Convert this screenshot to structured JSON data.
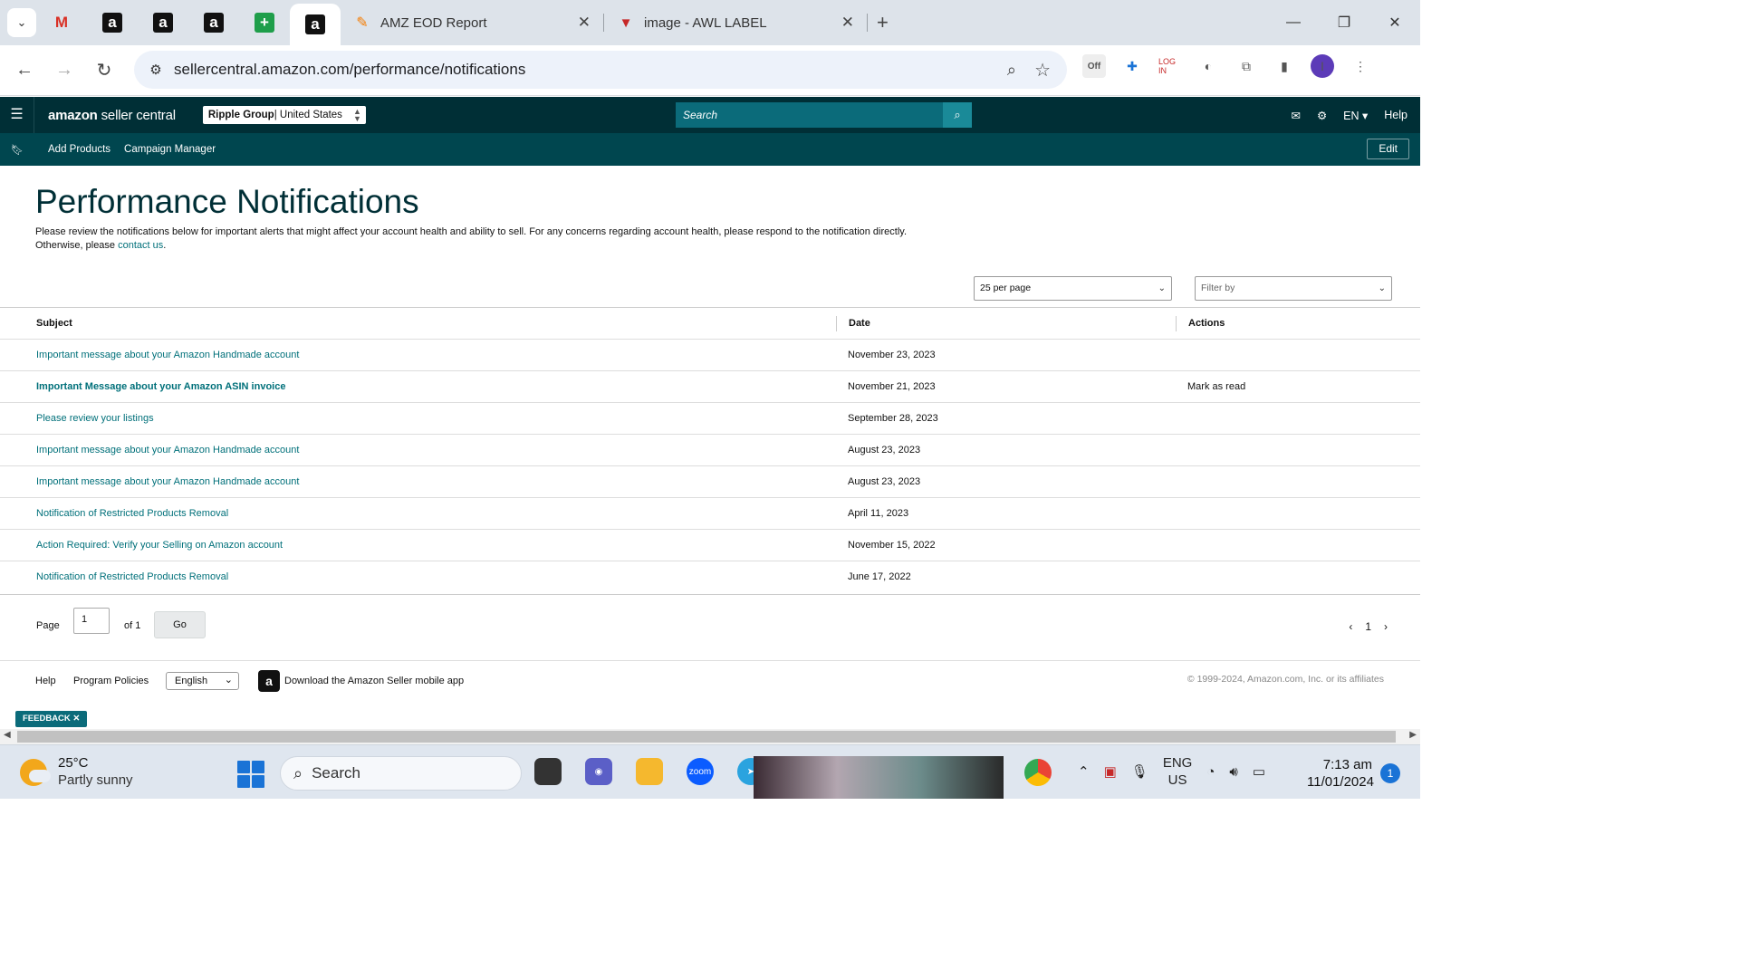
{
  "browser": {
    "tabs": [
      {
        "label": "AMZ EOD Report"
      },
      {
        "label": "image - AWL LABEL"
      }
    ],
    "url": "sellercentral.amazon.com/performance/notifications"
  },
  "header": {
    "logo_brand": "amazon",
    "logo_suffix": " seller central",
    "account_name": "Ripple Group",
    "account_region": " | United States",
    "search_placeholder": "Search",
    "lang": "EN",
    "help": "Help"
  },
  "bookmarks": {
    "items": [
      "Add Products",
      "Campaign Manager"
    ],
    "edit": "Edit"
  },
  "page": {
    "title": "Performance Notifications",
    "intro": "Please review the notifications below for important alerts that might affect your account health and ability to sell. For any concerns regarding account health, please respond to the notification directly. Otherwise, please",
    "contact_link": "contact us",
    "intro_end": ".",
    "per_page": "25 per page",
    "filter_placeholder": "Filter by"
  },
  "table": {
    "headers": [
      "Subject",
      "Date",
      "Actions"
    ],
    "rows": [
      {
        "subject": "Important message about your Amazon Handmade account",
        "date": "November 23, 2023",
        "action": ""
      },
      {
        "subject": "Important Message about your Amazon ASIN invoice",
        "date": "November 21, 2023",
        "action": "Mark as read"
      },
      {
        "subject": "Please review your listings",
        "date": "September 28, 2023",
        "action": ""
      },
      {
        "subject": "Important message about your Amazon Handmade account",
        "date": "August 23, 2023",
        "action": ""
      },
      {
        "subject": "Important message about your Amazon Handmade account",
        "date": "August 23, 2023",
        "action": ""
      },
      {
        "subject": "Notification of Restricted Products Removal",
        "date": "April 11, 2023",
        "action": ""
      },
      {
        "subject": "Action Required: Verify your Selling on Amazon account",
        "date": "November 15, 2022",
        "action": ""
      },
      {
        "subject": "Notification of Restricted Products Removal",
        "date": "June 17, 2022",
        "action": ""
      }
    ]
  },
  "pager": {
    "page_label": "Page",
    "page_value": "1",
    "of_label": "of 1",
    "go": "Go",
    "current": "1"
  },
  "footer": {
    "help": "Help",
    "policies": "Program Policies",
    "language": "English",
    "app": "Download the Amazon Seller mobile app",
    "copyright": "© 1999-2024, Amazon.com, Inc. or its affiliates",
    "feedback": "FEEDBACK"
  },
  "taskbar": {
    "temp": "25°C",
    "weather": "Partly sunny",
    "search": "Search",
    "lang1": "ENG",
    "lang2": "US",
    "time": "7:13 am",
    "date": "11/01/2024",
    "notifications": "1"
  },
  "colors": {
    "header_bg": "#002f36",
    "bookmark_bg": "#00464f",
    "link": "#00707a",
    "search_bg": "#0b6b7a"
  }
}
